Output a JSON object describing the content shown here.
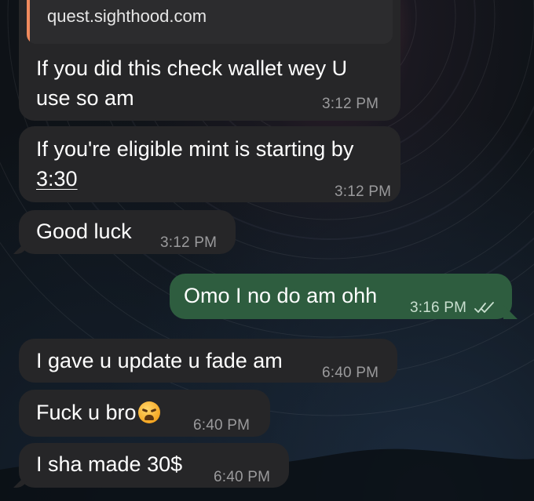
{
  "reply_preview": {
    "link_text": "quest.sighthood.com"
  },
  "messages": [
    {
      "direction": "incoming",
      "text": "If you did this check wallet wey U use so am",
      "time": "3:12 PM"
    },
    {
      "direction": "incoming",
      "text_before": "If you're eligible mint is starting by",
      "text_underlined": "3:30",
      "time": "3:12 PM"
    },
    {
      "direction": "incoming",
      "text": "Good luck",
      "time": "3:12 PM"
    },
    {
      "direction": "outgoing",
      "text": "Omo I no do am ohh",
      "time": "3:16 PM",
      "status": "read"
    },
    {
      "direction": "incoming",
      "text": "I gave u update u fade am",
      "time": "6:40 PM"
    },
    {
      "direction": "incoming",
      "text": "Fuck u bro",
      "emoji": "weary-face-icon",
      "time": "6:40 PM"
    },
    {
      "direction": "incoming",
      "text": "I sha made 30$",
      "time": "6:40 PM"
    }
  ],
  "colors": {
    "incoming_bubble": "#262628",
    "outgoing_bubble": "#2e5d3f",
    "reply_accent": "#f08a5d"
  }
}
